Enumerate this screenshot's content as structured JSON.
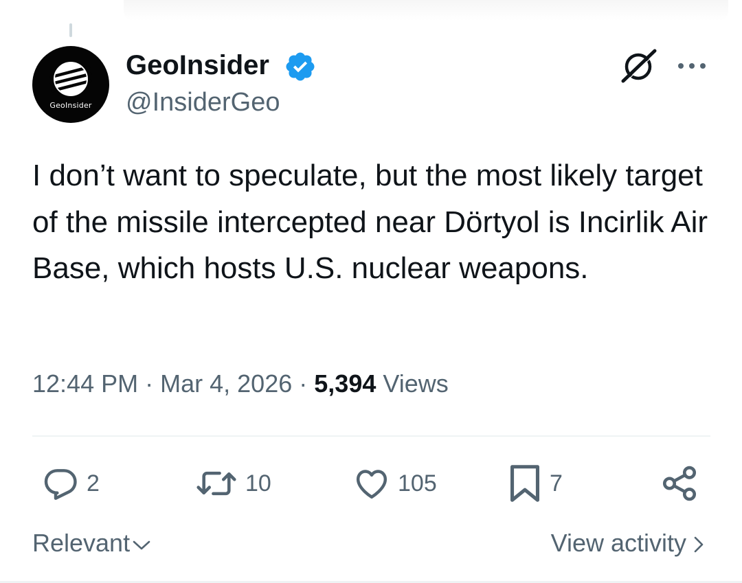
{
  "author": {
    "display_name": "GeoInsider",
    "handle": "@InsiderGeo",
    "avatar_text": "GeoInsider",
    "verified": true,
    "verified_color": "#1d9bf0"
  },
  "tweet": {
    "text": "I don’t want to speculate, but the most likely target of the missile intercepted near Dörtyol is Incirlik Air Base, which hosts U.S. nuclear weapons.",
    "time": "12:44 PM",
    "date": "Mar 4, 2026",
    "separator": "·",
    "views_count": "5,394",
    "views_label": "Views"
  },
  "actions": {
    "replies": "2",
    "reposts": "10",
    "likes": "105",
    "bookmarks": "7"
  },
  "footer": {
    "sort_label": "Relevant",
    "view_activity_label": "View activity"
  },
  "icons": {
    "header": [
      "grok-icon",
      "more-icon"
    ],
    "actions": [
      "reply-icon",
      "repost-icon",
      "like-icon",
      "bookmark-icon",
      "share-icon"
    ],
    "footer": [
      "chevron-down-icon",
      "chevron-right-icon"
    ]
  },
  "colors": {
    "text_primary": "#0f1419",
    "text_secondary": "#536471",
    "divider": "#eff3f4"
  }
}
